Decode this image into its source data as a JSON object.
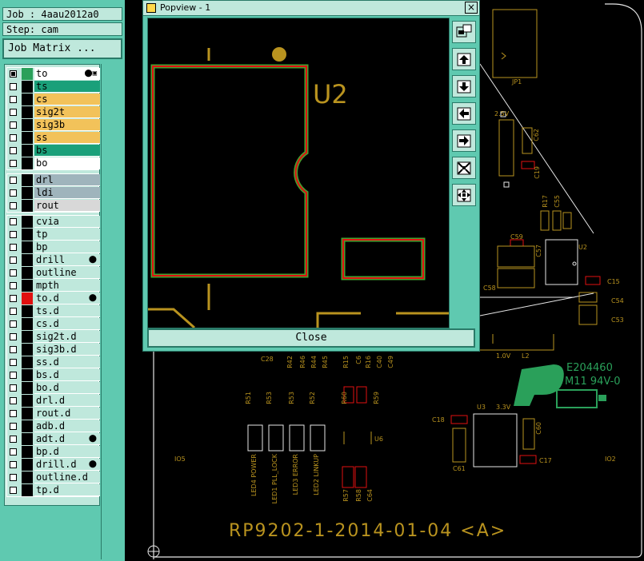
{
  "job_label": "Job : 4aau2012a0",
  "step_label": "Step: cam",
  "job_matrix_button": "Job Matrix ...",
  "layer_groups": [
    [
      {
        "name": "to",
        "color": "#ffffff",
        "check": "on",
        "swatch": "#2aa05a",
        "mark": "⬤▣"
      },
      {
        "name": "ts",
        "color": "#1aa07a",
        "check": "off",
        "swatch": "#000000",
        "mark": ""
      },
      {
        "name": "cs",
        "color": "#f2c25a",
        "check": "off",
        "swatch": "#000000",
        "mark": ""
      },
      {
        "name": "sig2t",
        "color": "#f2c25a",
        "check": "off",
        "swatch": "#000000",
        "mark": ""
      },
      {
        "name": "sig3b",
        "color": "#f2c25a",
        "check": "off",
        "swatch": "#000000",
        "mark": ""
      },
      {
        "name": "ss",
        "color": "#f2c25a",
        "check": "off",
        "swatch": "#000000",
        "mark": ""
      },
      {
        "name": "bs",
        "color": "#1aa07a",
        "check": "off",
        "swatch": "#000000",
        "mark": ""
      },
      {
        "name": "bo",
        "color": "#ffffff",
        "check": "off",
        "swatch": "#000000",
        "mark": ""
      }
    ],
    [
      {
        "name": "drl",
        "color": "#9fb4bc",
        "check": "off",
        "swatch": "#000000",
        "mark": ""
      },
      {
        "name": "ldi",
        "color": "#9fb4bc",
        "check": "off",
        "swatch": "#000000",
        "mark": ""
      },
      {
        "name": "rout",
        "color": "#d8d8d8",
        "check": "off",
        "swatch": "#000000",
        "mark": ""
      }
    ],
    [
      {
        "name": "cvia",
        "color": "#bfe8dc",
        "check": "off",
        "swatch": "#000000",
        "mark": ""
      },
      {
        "name": "tp",
        "color": "#bfe8dc",
        "check": "off",
        "swatch": "#000000",
        "mark": ""
      },
      {
        "name": "bp",
        "color": "#bfe8dc",
        "check": "off",
        "swatch": "#000000",
        "mark": ""
      },
      {
        "name": "drill",
        "color": "#bfe8dc",
        "check": "off",
        "swatch": "#000000",
        "mark": "⬤"
      },
      {
        "name": "outline",
        "color": "#bfe8dc",
        "check": "off",
        "swatch": "#000000",
        "mark": ""
      },
      {
        "name": "mpth",
        "color": "#bfe8dc",
        "check": "off",
        "swatch": "#000000",
        "mark": ""
      },
      {
        "name": "to.d",
        "color": "#bfe8dc",
        "check": "off",
        "swatch": "#e01010",
        "mark": "⬤"
      },
      {
        "name": "ts.d",
        "color": "#bfe8dc",
        "check": "off",
        "swatch": "#000000",
        "mark": ""
      },
      {
        "name": "cs.d",
        "color": "#bfe8dc",
        "check": "off",
        "swatch": "#000000",
        "mark": ""
      },
      {
        "name": "sig2t.d",
        "color": "#bfe8dc",
        "check": "off",
        "swatch": "#000000",
        "mark": ""
      },
      {
        "name": "sig3b.d",
        "color": "#bfe8dc",
        "check": "off",
        "swatch": "#000000",
        "mark": ""
      },
      {
        "name": "ss.d",
        "color": "#bfe8dc",
        "check": "off",
        "swatch": "#000000",
        "mark": ""
      },
      {
        "name": "bs.d",
        "color": "#bfe8dc",
        "check": "off",
        "swatch": "#000000",
        "mark": ""
      },
      {
        "name": "bo.d",
        "color": "#bfe8dc",
        "check": "off",
        "swatch": "#000000",
        "mark": ""
      },
      {
        "name": "drl.d",
        "color": "#bfe8dc",
        "check": "off",
        "swatch": "#000000",
        "mark": ""
      },
      {
        "name": "rout.d",
        "color": "#bfe8dc",
        "check": "off",
        "swatch": "#000000",
        "mark": ""
      },
      {
        "name": "adb.d",
        "color": "#bfe8dc",
        "check": "off",
        "swatch": "#000000",
        "mark": ""
      },
      {
        "name": "adt.d",
        "color": "#bfe8dc",
        "check": "off",
        "swatch": "#000000",
        "mark": "⬤"
      },
      {
        "name": "bp.d",
        "color": "#bfe8dc",
        "check": "off",
        "swatch": "#000000",
        "mark": ""
      },
      {
        "name": "drill.d",
        "color": "#bfe8dc",
        "check": "off",
        "swatch": "#000000",
        "mark": "⬤"
      },
      {
        "name": "outline.d",
        "color": "#bfe8dc",
        "check": "off",
        "swatch": "#000000",
        "mark": ""
      },
      {
        "name": "tp.d",
        "color": "#bfe8dc",
        "check": "off",
        "swatch": "#000000",
        "mark": ""
      }
    ]
  ],
  "popup": {
    "title": "Popview - 1",
    "close_x": "×",
    "close_button": "Close",
    "component_ref": "U2",
    "tools": [
      "zoom-to-fit-icon",
      "page-up-icon",
      "page-down-icon",
      "page-left-icon",
      "page-right-icon",
      "zoom-in-icon",
      "pan-icon"
    ]
  },
  "board_labels": {
    "main_marking": "RP9202-1-2014-01-04  <A>",
    "ul_code": "E204460",
    "ul_rating": "M11 94V-0",
    "jp1": "JP1",
    "u2": "U2",
    "u3": "U3",
    "u6": "U6",
    "v33": "3.3V",
    "v10": "1.0V",
    "l2": "L2",
    "v25": "2.5V",
    "io5": "IO5",
    "io2": "IO2",
    "c15": "C15",
    "c54": "C54",
    "c53": "C53",
    "c56": "C56",
    "c57": "C57",
    "c59": "C59",
    "c18": "C18",
    "c61": "C61",
    "c17": "C17",
    "c60": "C60",
    "c62": "C62",
    "c19": "C19",
    "r17": "R17",
    "c55": "C55",
    "c58": "C58",
    "c28": "C28",
    "leds": [
      "LED4 POWER",
      "LED1 PLL_LOCK",
      "LED3 ERROR",
      "LED2 LINKUP"
    ],
    "rtop": [
      "R51",
      "R53",
      "R53",
      "R52",
      "R60",
      "R59"
    ],
    "rrow": [
      "R42",
      "R46",
      "R44",
      "R45",
      "R15",
      "C6",
      "R16",
      "C40",
      "C49"
    ],
    "rbot": [
      "R57",
      "R58",
      "C64"
    ]
  },
  "colors": {
    "panel": "#5fc9b0",
    "panel_light": "#bfe8dc",
    "pcb_gold": "#b9931f",
    "pad_red": "#e01010",
    "pad_green": "#44a030",
    "outline_white": "#e6e6e6"
  }
}
